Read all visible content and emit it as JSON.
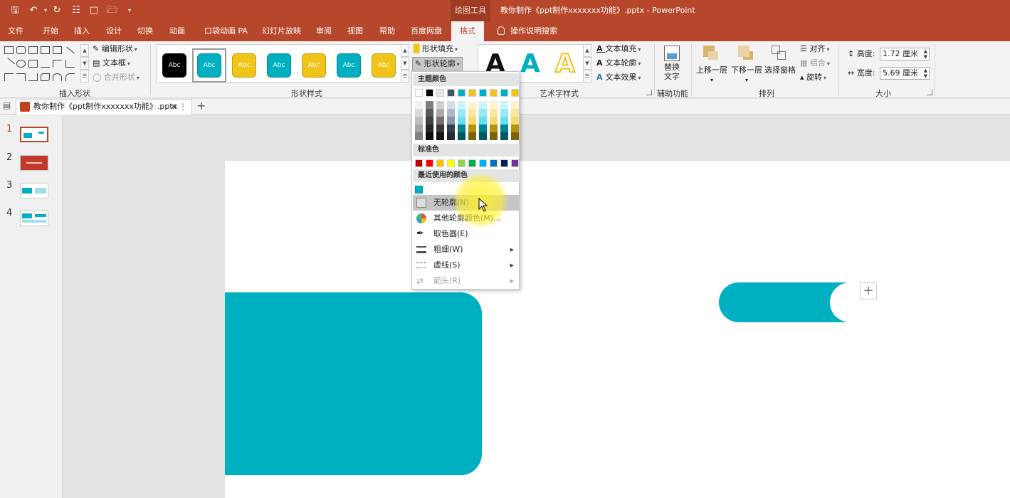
{
  "app": {
    "tools_label": "绘图工具",
    "doc_title": "教你制作《ppt制作xxxxxxx功能》.pptx  -  PowerPoint"
  },
  "tabs": [
    {
      "label": "文件"
    },
    {
      "label": "开始"
    },
    {
      "label": "插入"
    },
    {
      "label": "设计"
    },
    {
      "label": "切换"
    },
    {
      "label": "动画"
    },
    {
      "label": "口袋动画 PA"
    },
    {
      "label": "幻灯片放映"
    },
    {
      "label": "审阅"
    },
    {
      "label": "视图"
    },
    {
      "label": "帮助"
    },
    {
      "label": "百度网盘"
    },
    {
      "label": "格式"
    }
  ],
  "tell_me": "操作说明搜索",
  "ribbon": {
    "insert_shapes": {
      "label": "插入形状",
      "edit_shape": "编辑形状",
      "text_box": "文本框",
      "merge_shapes": "合并形状"
    },
    "shape_styles": {
      "label": "形状样式",
      "gallery_text": "Abc",
      "shape_fill": "形状填充",
      "shape_outline": "形状轮廓"
    },
    "wordart": {
      "label": "艺术字样式",
      "glyph": "A",
      "text_fill": "文本填充",
      "text_outline": "文本轮廓",
      "text_effects": "文本效果"
    },
    "accessibility": {
      "label": "辅助功能",
      "alt_text_1": "替换",
      "alt_text_2": "文字"
    },
    "arrange": {
      "label": "排列",
      "bring_forward": "上移一层",
      "send_backward": "下移一层",
      "selection_pane": "选择窗格",
      "align": "对齐",
      "group": "组合",
      "rotate": "旋转"
    },
    "size": {
      "label": "大小",
      "height_label": "高度:",
      "height_value": "1.72 厘米",
      "width_label": "宽度:",
      "width_value": "5.69 厘米"
    }
  },
  "document_tab": "教你制作《ppt制作xxxxxxx功能》.pptx",
  "slides": [
    {
      "num": "1"
    },
    {
      "num": "2"
    },
    {
      "num": "3"
    },
    {
      "num": "4"
    }
  ],
  "dropdown": {
    "theme_colors": "主题颜色",
    "standard_colors": "标准色",
    "recent_colors": "最近使用的颜色",
    "no_outline": "无轮廓(N)",
    "more_colors": "其他轮廓颜色(M)...",
    "eyedropper": "取色器(E)",
    "weight": "粗细(W)",
    "dashes": "虚线(S)",
    "arrows": "箭头(R)"
  },
  "colors": {
    "accent": "#b7472a",
    "teal": "#00b0c1",
    "theme_row": [
      "#ffffff",
      "#000000",
      "#e7e6e6",
      "#44546a",
      "#00b0c1",
      "#f0c419",
      "#00b0c1",
      "#f0c419",
      "#00b0c1",
      "#f0c419"
    ],
    "standard_row": [
      "#c00000",
      "#ff0000",
      "#ffc000",
      "#ffff00",
      "#92d050",
      "#00b050",
      "#00b0f0",
      "#0070c0",
      "#002060",
      "#7030a0"
    ],
    "recent": [
      "#00b0c1"
    ]
  }
}
